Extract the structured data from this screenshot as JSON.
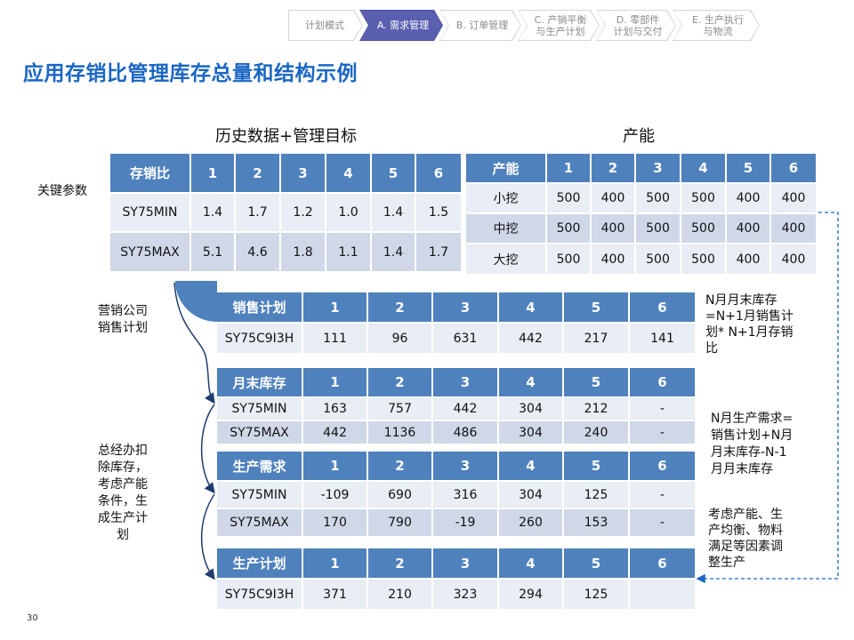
{
  "breadcrumb": [
    {
      "label": "计划模式"
    },
    {
      "label": "A. 需求管理"
    },
    {
      "label": "B. 订单管理"
    },
    {
      "label": "C. 产销平衡\n与生产计划"
    },
    {
      "label": "D. 零部件\n计划与交付"
    },
    {
      "label": "E. 生产执行\n与物流"
    }
  ],
  "title": "应用存销比管理库存总量和结构示例",
  "history_section_title": "历史数据+管理目标",
  "capacity_section_title": "产能",
  "key_params_label": "关键参数",
  "notes": {
    "sales_company": "营销公司\n销售计划",
    "hq": "总经办扣\n除库存，\n考虑产能\n条件，生\n成生产计\n划",
    "month_end_formula": "N月月末库存\n=N+1月销售计\n划* N+1月存销\n比",
    "prod_demand_formula": "N月生产需求=\n销售计划+N月\n月末库存-N-1\n月月末库存",
    "adjust": "考虑产能、生\n产均衡、物料\n满足等因素调\n整生产"
  },
  "tables": {
    "ratio": {
      "header": [
        "存销比",
        "1",
        "2",
        "3",
        "4",
        "5",
        "6"
      ],
      "rows": [
        [
          "SY75MIN",
          "1.4",
          "1.7",
          "1.2",
          "1.0",
          "1.4",
          "1.5"
        ],
        [
          "SY75MAX",
          "5.1",
          "4.6",
          "1.8",
          "1.1",
          "1.4",
          "1.7"
        ]
      ]
    },
    "capacity": {
      "header": [
        "产能",
        "1",
        "2",
        "3",
        "4",
        "5",
        "6"
      ],
      "rows": [
        [
          "小挖",
          "500",
          "400",
          "500",
          "500",
          "400",
          "400"
        ],
        [
          "中挖",
          "500",
          "400",
          "500",
          "500",
          "400",
          "400"
        ],
        [
          "大挖",
          "500",
          "400",
          "500",
          "500",
          "400",
          "400"
        ]
      ]
    },
    "sales_plan": {
      "header": [
        "销售计划",
        "1",
        "2",
        "3",
        "4",
        "5",
        "6"
      ],
      "rows": [
        [
          "SY75C9I3H",
          "111",
          "96",
          "631",
          "442",
          "217",
          "141"
        ]
      ]
    },
    "month_end_inventory": {
      "header": [
        "月末库存",
        "1",
        "2",
        "3",
        "4",
        "5",
        "6"
      ],
      "rows": [
        [
          "SY75MIN",
          "163",
          "757",
          "442",
          "304",
          "212",
          "-"
        ],
        [
          "SY75MAX",
          "442",
          "1136",
          "486",
          "304",
          "240",
          "-"
        ]
      ]
    },
    "production_demand": {
      "header": [
        "生产需求",
        "1",
        "2",
        "3",
        "4",
        "5",
        "6"
      ],
      "rows": [
        [
          "SY75MIN",
          "-109",
          "690",
          "316",
          "304",
          "125",
          "-"
        ],
        [
          "SY75MAX",
          "170",
          "790",
          "-19",
          "260",
          "153",
          "-"
        ]
      ]
    },
    "production_plan": {
      "header": [
        "生产计划",
        "1",
        "2",
        "3",
        "4",
        "5",
        "6"
      ],
      "rows": [
        [
          "SY75C9I3H",
          "371",
          "210",
          "323",
          "294",
          "125",
          ""
        ]
      ]
    }
  },
  "page_number": "30"
}
